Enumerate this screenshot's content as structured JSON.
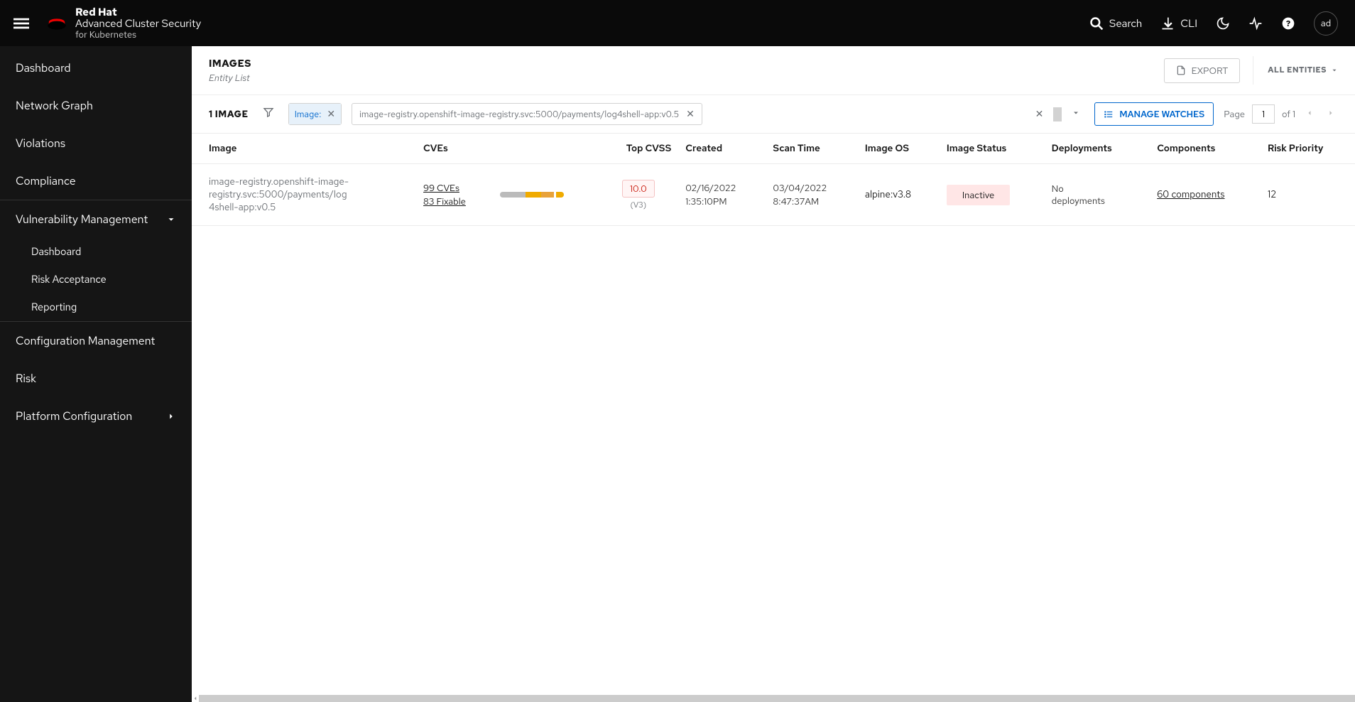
{
  "header": {
    "brand_top": "Red Hat",
    "brand_mid": "Advanced Cluster Security",
    "brand_bot": "for Kubernetes",
    "search_label": "Search",
    "cli_label": "CLI",
    "avatar": "ad"
  },
  "sidebar": {
    "items": [
      {
        "label": "Dashboard"
      },
      {
        "label": "Network Graph"
      },
      {
        "label": "Violations"
      },
      {
        "label": "Compliance"
      }
    ],
    "group_label": "Vulnerability Management",
    "group_children": [
      {
        "label": "Dashboard"
      },
      {
        "label": "Risk Acceptance"
      },
      {
        "label": "Reporting"
      }
    ],
    "after": [
      {
        "label": "Configuration Management"
      },
      {
        "label": "Risk"
      },
      {
        "label": "Platform Configuration",
        "expandable": true
      }
    ]
  },
  "head": {
    "title": "IMAGES",
    "subtitle": "Entity List",
    "export": "EXPORT",
    "entities": "ALL ENTITIES"
  },
  "filter": {
    "count": "1 IMAGE",
    "chip_key": "Image:",
    "chip_value": "image-registry.openshift-image-registry.svc:5000/payments/log4shell-app:v0.5",
    "manage": "MANAGE WATCHES",
    "page_label": "Page",
    "page_current": "1",
    "page_of": "of 1"
  },
  "columns": {
    "image": "Image",
    "cves": "CVEs",
    "cvss": "Top CVSS",
    "created": "Created",
    "scan": "Scan Time",
    "os": "Image OS",
    "status": "Image Status",
    "dep": "Deployments",
    "comp": "Components",
    "risk": "Risk Priority"
  },
  "row": {
    "image": "image-registry.openshift-image-registry.svc:5000/payments/log4shell-app:v0.5",
    "cves_count": "99 CVEs",
    "cves_fixable": "83 Fixable",
    "cvss": "10.0",
    "cvss_ver": "(V3)",
    "created_date": "02/16/2022",
    "created_time": "1:35:10PM",
    "scan_date": "03/04/2022",
    "scan_time": "8:47:37AM",
    "os": "alpine:v3.8",
    "status": "Inactive",
    "dep": "No deployments",
    "comp": "60 components",
    "risk": "12"
  }
}
